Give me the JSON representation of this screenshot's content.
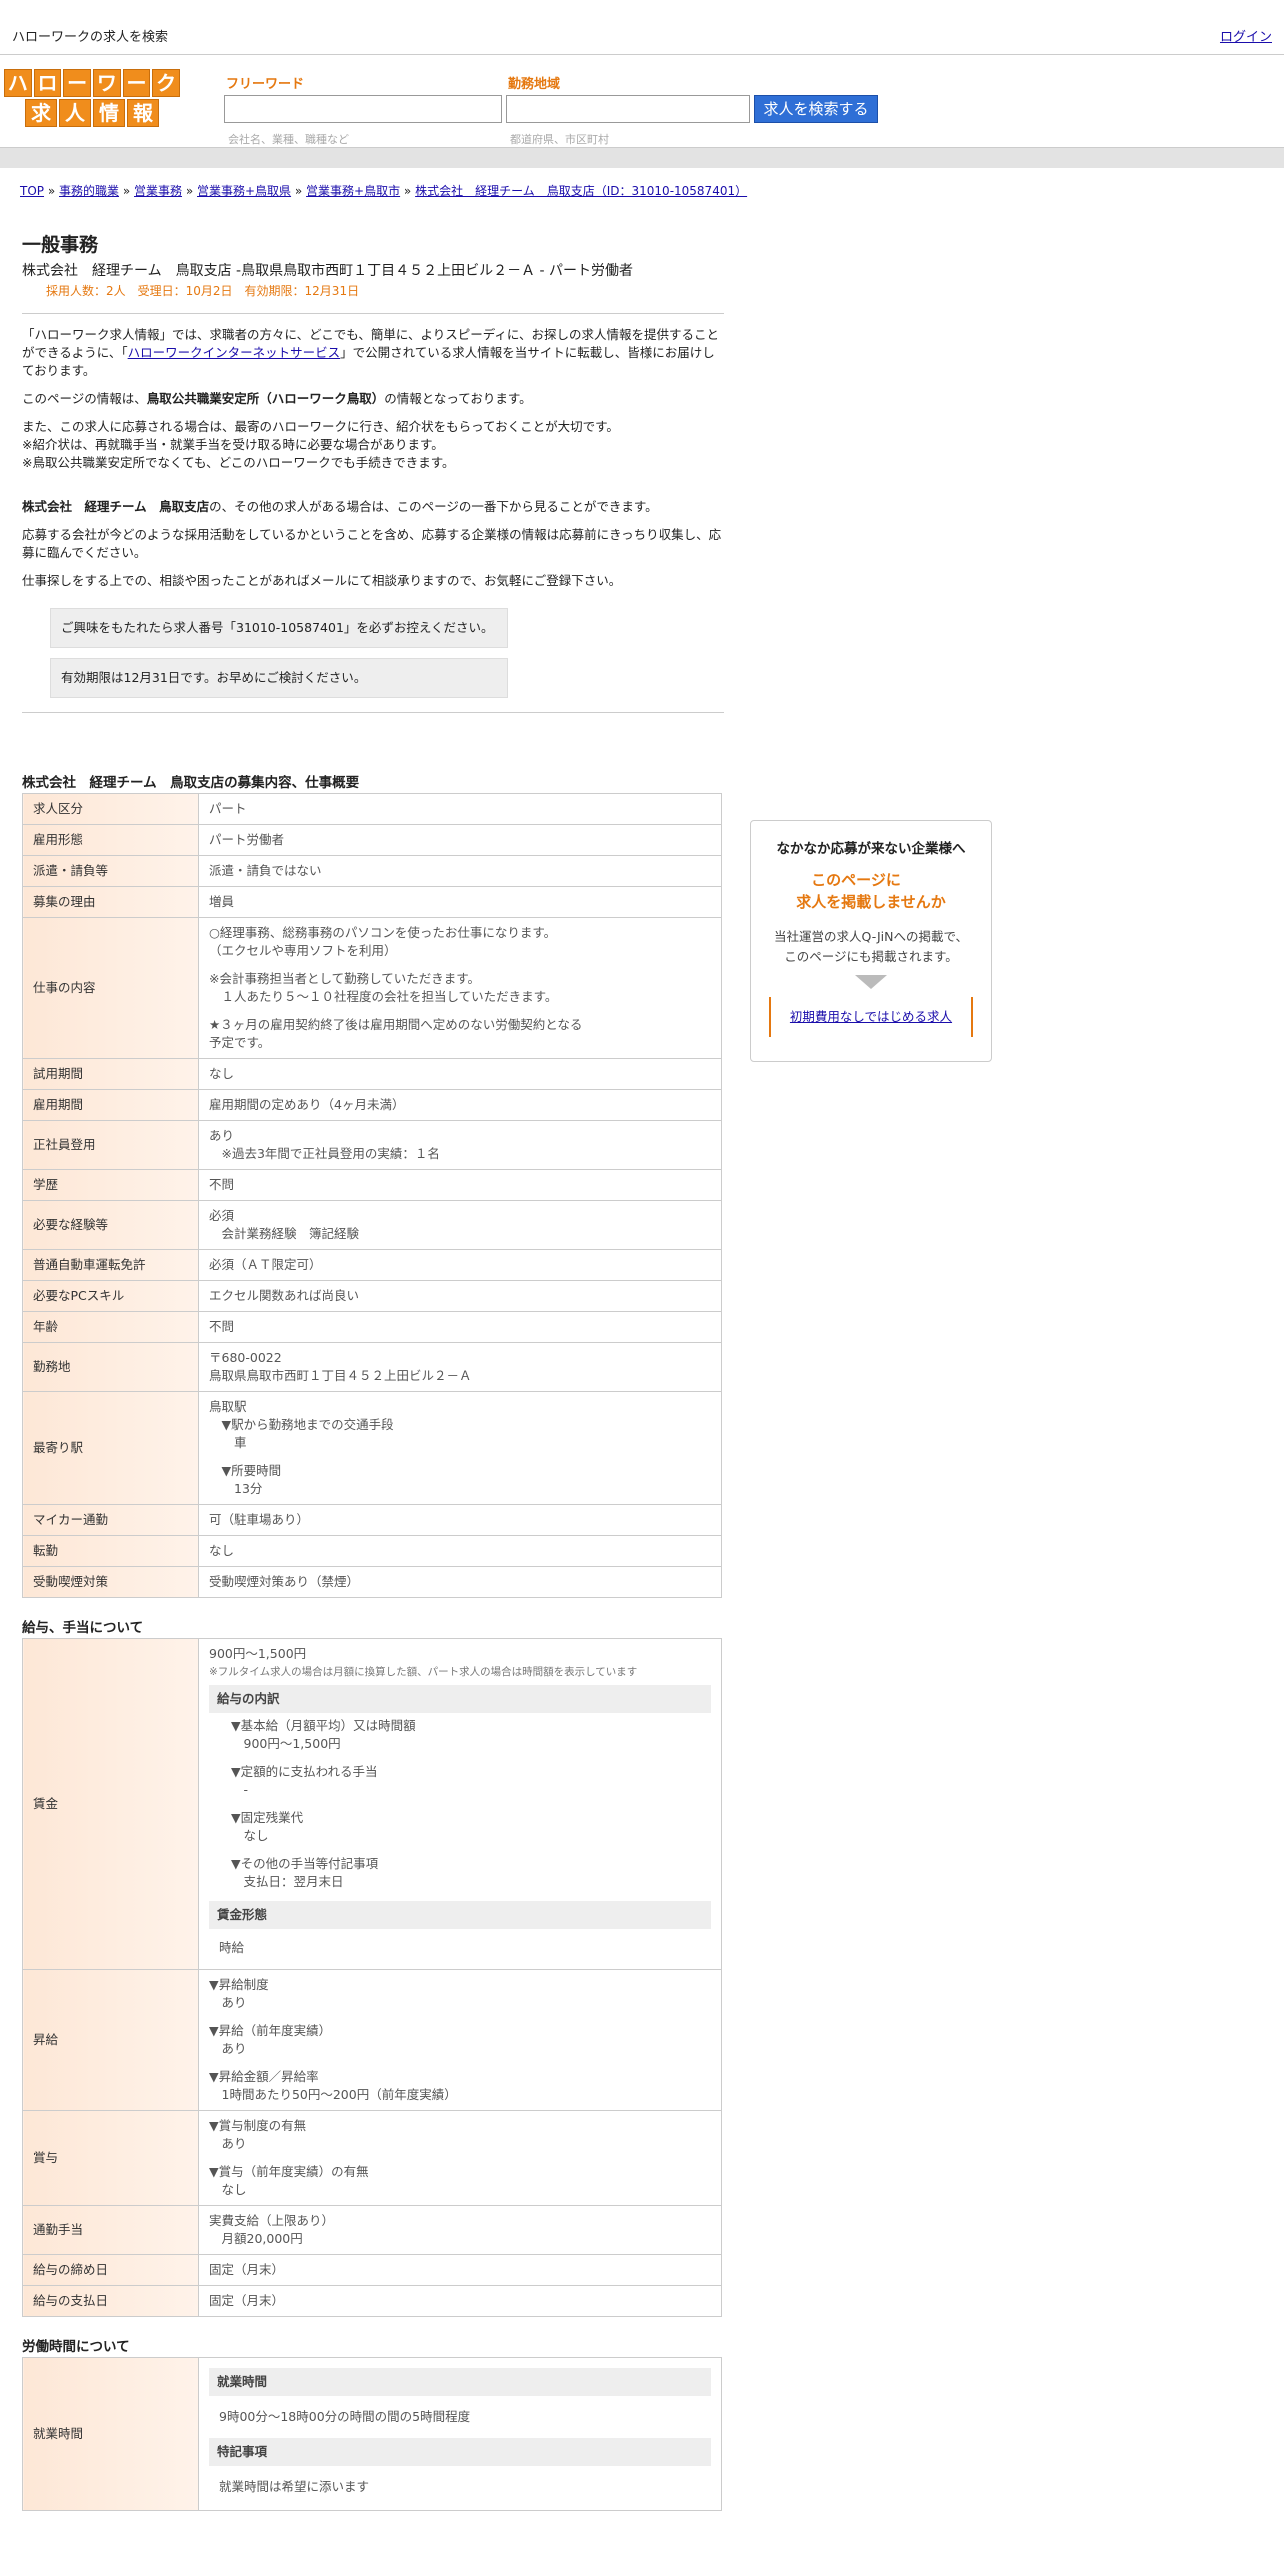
{
  "site": {
    "title": "ハローワークの求人を検索",
    "login": "ログイン"
  },
  "logo": {
    "row1": [
      "ハ",
      "ロ",
      "ー",
      "ワ",
      "ー",
      "ク"
    ],
    "row2": [
      "求",
      "人",
      "情",
      "報"
    ]
  },
  "search": {
    "keyword_label": "フリーワード",
    "keyword_hint": "会社名、業種、職種など",
    "area_label": "勤務地域",
    "area_hint": "都道府県、市区町村",
    "button": "求人を検索する"
  },
  "breadcrumb": [
    "TOP",
    "事務的職業",
    "営業事務",
    "営業事務+鳥取県",
    "営業事務+鳥取市",
    "株式会社　経理チーム　鳥取支店（ID：31010-10587401）"
  ],
  "job": {
    "title": "一般事務",
    "company_line": "株式会社　経理チーム　鳥取支店 -鳥取県鳥取市西町１丁目４５２上田ビル２－Ａ - パート労働者",
    "meta": "採用人数：2人　受理日：10月2日　有効期限：12月31日"
  },
  "intro": {
    "p1a": "「ハローワーク求人情報」では、求職者の方々に、どこでも、簡単に、よりスピーディに、お探しの求人情報を提供することができるように、「",
    "p1link": "ハローワークインターネットサービス",
    "p1b": "」で公開されている求人情報を当サイトに転載し、皆様にお届けしております。",
    "p2a": "このページの情報は、",
    "p2b": "鳥取公共職業安定所（ハローワーク鳥取）",
    "p2c": "の情報となっております。",
    "p3": "また、この求人に応募される場合は、最寄のハローワークに行き、紹介状をもらっておくことが大切です。",
    "p4": "※紹介状は、再就職手当・就業手当を受け取る時に必要な場合があります。",
    "p5": "※鳥取公共職業安定所でなくても、どこのハローワークでも手続きできます。",
    "p6a": "株式会社　経理チーム　鳥取支店",
    "p6b": "の、その他の求人がある場合は、このページの一番下から見ることができます。",
    "p7": "応募する会社が今どのような採用活動をしているかということを含め、応募する企業様の情報は応募前にきっちり収集し、応募に臨んでください。",
    "p8": "仕事探しをする上での、相談や困ったことがあればメールにて相談承りますので、お気軽にご登録下さい。",
    "notice1": "ご興味をもたれたら求人番号「31010-10587401」を必ずお控えください。",
    "notice2": "有効期限は12月31日です。お早めにご検討ください。"
  },
  "sec1": {
    "title": "株式会社　経理チーム　鳥取支店の募集内容、仕事概要",
    "rows": [
      {
        "k": "求人区分",
        "v": [
          "パート"
        ]
      },
      {
        "k": "雇用形態",
        "v": [
          "パート労働者"
        ]
      },
      {
        "k": "派遣・請負等",
        "v": [
          "派遣・請負ではない"
        ]
      },
      {
        "k": "募集の理由",
        "v": [
          "増員"
        ]
      },
      {
        "k": "仕事の内容",
        "v": [
          "○経理事務、総務事務のパソコンを使ったお仕事になります。",
          "（エクセルや専用ソフトを利用）",
          "",
          "※会計事務担当者として勤務していただきます。",
          "　１人あたり５～１０社程度の会社を担当していただきます。",
          "",
          "★３ヶ月の雇用契約終了後は雇用期間へ定めのない労働契約となる",
          "予定です。"
        ]
      },
      {
        "k": "試用期間",
        "v": [
          "なし"
        ]
      },
      {
        "k": "雇用期間",
        "v": [
          "雇用期間の定めあり（4ヶ月未満）"
        ]
      },
      {
        "k": "正社員登用",
        "v": [
          "あり",
          "　※過去3年間で正社員登用の実績：１名"
        ]
      },
      {
        "k": "学歴",
        "v": [
          "不問"
        ]
      },
      {
        "k": "必要な経験等",
        "v": [
          "必須",
          "　会計業務経験　簿記経験"
        ]
      },
      {
        "k": "普通自動車運転免許",
        "v": [
          "必須（ＡＴ限定可）"
        ]
      },
      {
        "k": "必要なPCスキル",
        "v": [
          "エクセル関数あれば尚良い"
        ]
      },
      {
        "k": "年齢",
        "v": [
          "不問"
        ]
      },
      {
        "k": "勤務地",
        "v": [
          "〒680-0022",
          "鳥取県鳥取市西町１丁目４５２上田ビル２－Ａ"
        ]
      },
      {
        "k": "最寄り駅",
        "v": [
          "鳥取駅",
          "　▼駅から勤務地までの交通手段",
          "　　車",
          "",
          "　▼所要時間",
          "　　13分"
        ]
      },
      {
        "k": "マイカー通勤",
        "v": [
          "可（駐車場あり）"
        ]
      },
      {
        "k": "転勤",
        "v": [
          "なし"
        ]
      },
      {
        "k": "受動喫煙対策",
        "v": [
          "受動喫煙対策あり（禁煙）"
        ]
      }
    ]
  },
  "sec2": {
    "title": "給与、手当について",
    "wage_k": "賃金",
    "wage_main": "900円〜1,500円",
    "wage_note": "※フルタイム求人の場合は月額に換算した額、パート求人の場合は時間額を表示しています",
    "wage_breakdown_title": "給与の内訳",
    "wage_breakdown": [
      "▼基本給（月額平均）又は時間額",
      "　900円〜1,500円",
      "",
      "▼定額的に支払われる手当",
      "　-",
      "",
      "▼固定残業代",
      "　なし",
      "",
      "▼その他の手当等付記事項",
      "　支払日：翌月末日"
    ],
    "wage_form_title": "賃金形態",
    "wage_form": "時給",
    "rows": [
      {
        "k": "昇給",
        "v": [
          "▼昇給制度",
          "　あり",
          "",
          "▼昇給（前年度実績）",
          "　あり",
          "",
          "▼昇給金額／昇給率",
          "　1時間あたり50円〜200円（前年度実績）"
        ]
      },
      {
        "k": "賞与",
        "v": [
          "▼賞与制度の有無",
          "　あり",
          "",
          "▼賞与（前年度実績）の有無",
          "　なし"
        ]
      },
      {
        "k": "通勤手当",
        "v": [
          "実費支給（上限あり）",
          "　月額20,000円"
        ]
      },
      {
        "k": "給与の締め日",
        "v": [
          "固定（月末）"
        ]
      },
      {
        "k": "給与の支払日",
        "v": [
          "固定（月末）"
        ]
      }
    ]
  },
  "sec3": {
    "title": "労働時間について",
    "k": "就業時間",
    "box1": "就業時間",
    "v1": "9時00分〜18時00分の時間の間の5時間程度",
    "box2": "特記事項",
    "v2": "就業時間は希望に添います"
  },
  "side": {
    "title": "なかなか応募が来ない企業様へ",
    "catch1": "このページに",
    "catch2": "求人を掲載しませんか",
    "text1": "当社運営の求人Q-JiNへの掲載で、",
    "text2": "このページにも掲載されます。",
    "link": "初期費用なしではじめる求人"
  }
}
